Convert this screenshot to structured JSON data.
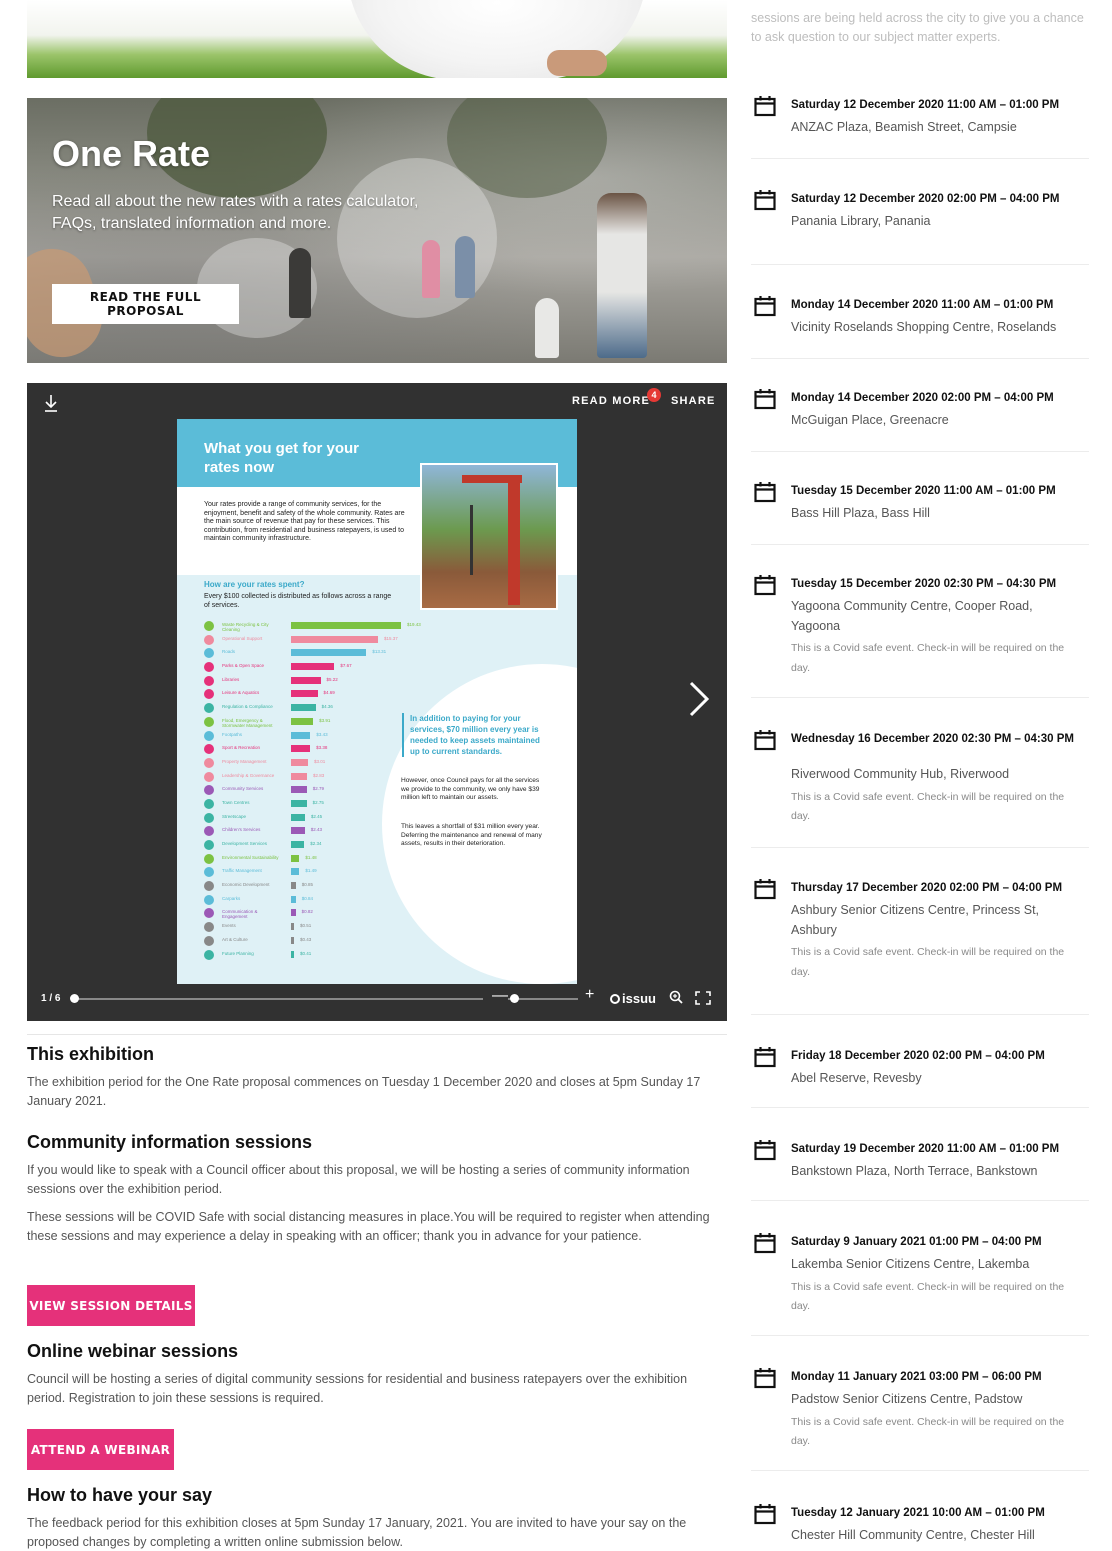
{
  "hero": {
    "title": "One Rate",
    "text": "Read all about the new rates with a rates calculator, FAQs, translated information and more.",
    "button_label": "READ THE FULL PROPOSAL"
  },
  "viewer": {
    "read_more_label": "READ MORE",
    "read_more_badge": "4",
    "share_label": "SHARE",
    "page_indicator": "1 / 6",
    "brand": "issuu",
    "current_page_fraction": 0.0,
    "icons": [
      "download-icon",
      "chevron-right-icon",
      "zoom-minus-icon",
      "zoom-plus-icon",
      "magnifier-icon",
      "fullscreen-icon"
    ],
    "document": {
      "title": "What you get for your rates now",
      "intro": "Your rates provide a range of community services, for the enjoyment, benefit and safety of the whole community. Rates are the main source of revenue that pay for these services. This contribution, from residential and business ratepayers, is used to maintain community infrastructure.",
      "subheading": "How are your rates spent?",
      "subtext": "Every $100 collected is distributed as follows across a range of services.",
      "quote": "In addition to paying for your services, $70 million every year is needed to keep assets maintained up to current standards.",
      "text1": "However, once Council pays for all the services we provide to the community, we only have $39 million left to maintain our assets.",
      "text2": "This leaves a shortfall of $31 million every year. Deferring the maintenance and renewal of many assets, results in their deterioration.",
      "spending": [
        {
          "label": "Waste Recycling & City Cleaning",
          "value": 19.43,
          "display": "$19.43",
          "color": "#7cc242"
        },
        {
          "label": "Operational Support",
          "value": 15.37,
          "display": "$15.37",
          "color": "#ef8a9e"
        },
        {
          "label": "Roads",
          "value": 13.31,
          "display": "$13.31",
          "color": "#5bbcd8"
        },
        {
          "label": "Parks & Open Space",
          "value": 7.67,
          "display": "$7.67",
          "color": "#e5317a"
        },
        {
          "label": "Libraries",
          "value": 5.22,
          "display": "$5.22",
          "color": "#e5317a"
        },
        {
          "label": "Leisure & Aquatics",
          "value": 4.69,
          "display": "$4.69",
          "color": "#e5317a"
        },
        {
          "label": "Regulation & Compliance",
          "value": 4.36,
          "display": "$4.36",
          "color": "#3bb4a3"
        },
        {
          "label": "Flood, Emergency & Stormwater Management",
          "value": 3.91,
          "display": "$3.91",
          "color": "#7cc242"
        },
        {
          "label": "Footpaths",
          "value": 3.43,
          "display": "$3.43",
          "color": "#5bbcd8"
        },
        {
          "label": "Sport & Recreation",
          "value": 3.38,
          "display": "$3.38",
          "color": "#e5317a"
        },
        {
          "label": "Property Management",
          "value": 3.01,
          "display": "$3.01",
          "color": "#ef8a9e"
        },
        {
          "label": "Leadership & Governance",
          "value": 2.83,
          "display": "$2.83",
          "color": "#ef8a9e"
        },
        {
          "label": "Community Services",
          "value": 2.79,
          "display": "$2.79",
          "color": "#9b59b6"
        },
        {
          "label": "Town Centres",
          "value": 2.75,
          "display": "$2.75",
          "color": "#3bb4a3"
        },
        {
          "label": "Streetscape",
          "value": 2.45,
          "display": "$2.45",
          "color": "#3bb4a3"
        },
        {
          "label": "Children's Services",
          "value": 2.43,
          "display": "$2.43",
          "color": "#9b59b6"
        },
        {
          "label": "Development Services",
          "value": 2.34,
          "display": "$2.34",
          "color": "#3bb4a3"
        },
        {
          "label": "Environmental Sustainability",
          "value": 1.48,
          "display": "$1.48",
          "color": "#7cc242"
        },
        {
          "label": "Traffic Management",
          "value": 1.49,
          "display": "$1.49",
          "color": "#5bbcd8"
        },
        {
          "label": "Economic Development",
          "value": 0.85,
          "display": "$0.85",
          "color": "#888888"
        },
        {
          "label": "Carparks",
          "value": 0.84,
          "display": "$0.84",
          "color": "#5bbcd8"
        },
        {
          "label": "Communication & Engagement",
          "value": 0.82,
          "display": "$0.82",
          "color": "#9b59b6"
        },
        {
          "label": "Events",
          "value": 0.51,
          "display": "$0.51",
          "color": "#888888"
        },
        {
          "label": "Art & Culture",
          "value": 0.43,
          "display": "$0.43",
          "color": "#888888"
        },
        {
          "label": "Future Planning",
          "value": 0.41,
          "display": "$0.41",
          "color": "#3bb4a3"
        }
      ]
    }
  },
  "sections": {
    "exhibition": {
      "heading": "This exhibition",
      "text": "The exhibition period for the One Rate proposal commences on Tuesday 1 December 2020 and closes at 5pm Sunday 17 January 2021."
    },
    "community": {
      "heading": "Community information sessions",
      "text1": "If you would like to speak with a Council officer about this proposal, we will be hosting a series of community information sessions over the exhibition period.",
      "text2": "These sessions will be COVID Safe with social distancing measures in place.You will be required to register when attending these sessions and may experience a delay in speaking with an officer; thank you in advance for your patience.",
      "button_label": "VIEW SESSION DETAILS"
    },
    "webinar": {
      "heading": "Online webinar sessions",
      "text": "Council will be hosting a series of digital community sessions for residential and business ratepayers over the exhibition period. Registration to join these sessions is required.",
      "button_label": "ATTEND A WEBINAR"
    },
    "say": {
      "heading": "How to have your say",
      "text": "The feedback period for this exhibition closes at 5pm Sunday 17 January, 2021. You are invited to have your say on the proposed changes by completing a written online submission below."
    }
  },
  "sidebar": {
    "intro": "sessions are being held across the city to give you a chance to ask question to our subject matter experts.",
    "covid_note": "This is a Covid safe event. Check-in will be required on the day.",
    "events": [
      {
        "date": "Saturday 12 December 2020 11:00 AM – 01:00 PM",
        "location": "ANZAC Plaza, Beamish Street, Campsie",
        "note": ""
      },
      {
        "date": "Saturday 12 December 2020 02:00 PM – 04:00 PM",
        "location": "Panania Library, Panania",
        "note": ""
      },
      {
        "date": "Monday 14 December 2020 11:00 AM – 01:00 PM",
        "location": "Vicinity Roselands Shopping Centre, Roselands",
        "note": ""
      },
      {
        "date": "Monday 14 December 2020 02:00 PM – 04:00 PM",
        "location": "McGuigan Place, Greenacre",
        "note": ""
      },
      {
        "date": "Tuesday 15 December 2020 11:00 AM – 01:00 PM",
        "location": "Bass Hill Plaza, Bass Hill",
        "note": ""
      },
      {
        "date": "Tuesday 15 December 2020 02:30 PM – 04:30 PM",
        "location": "Yagoona Community Centre, Cooper Road, Yagoona",
        "note": "This is a Covid safe event. Check-in will be required on the day."
      },
      {
        "date": "Wednesday 16 December 2020 02:30 PM – 04:30 PM",
        "location": "Riverwood Community Hub, Riverwood",
        "note": "This is a Covid safe event. Check-in will be required on the day."
      },
      {
        "date": "Thursday 17 December 2020 02:00 PM – 04:00 PM",
        "location": "Ashbury Senior Citizens Centre, Princess St, Ashbury",
        "note": "This is a Covid safe event. Check-in will be required on the day."
      },
      {
        "date": "Friday 18 December 2020 02:00 PM – 04:00 PM",
        "location": "Abel Reserve, Revesby",
        "note": ""
      },
      {
        "date": "Saturday 19 December 2020 11:00 AM – 01:00 PM",
        "location": "Bankstown Plaza, North Terrace, Bankstown",
        "note": ""
      },
      {
        "date": "Saturday 9 January 2021 01:00 PM – 04:00 PM",
        "location": "Lakemba Senior Citizens Centre, Lakemba",
        "note": "This is a Covid safe event. Check-in will be required on the day."
      },
      {
        "date": "Monday 11 January 2021 03:00 PM – 06:00 PM",
        "location": "Padstow Senior Citizens Centre, Padstow",
        "note": "This is a Covid safe event. Check-in will be required on the day."
      },
      {
        "date": "Tuesday 12 January 2021 10:00 AM – 01:00 PM",
        "location": "Chester Hill Community Centre, Chester Hill",
        "note": ""
      }
    ]
  },
  "colors": {
    "accent_pink": "#e5317a",
    "viewer_bg": "#313131",
    "doc_blue": "#5bbcd8"
  }
}
